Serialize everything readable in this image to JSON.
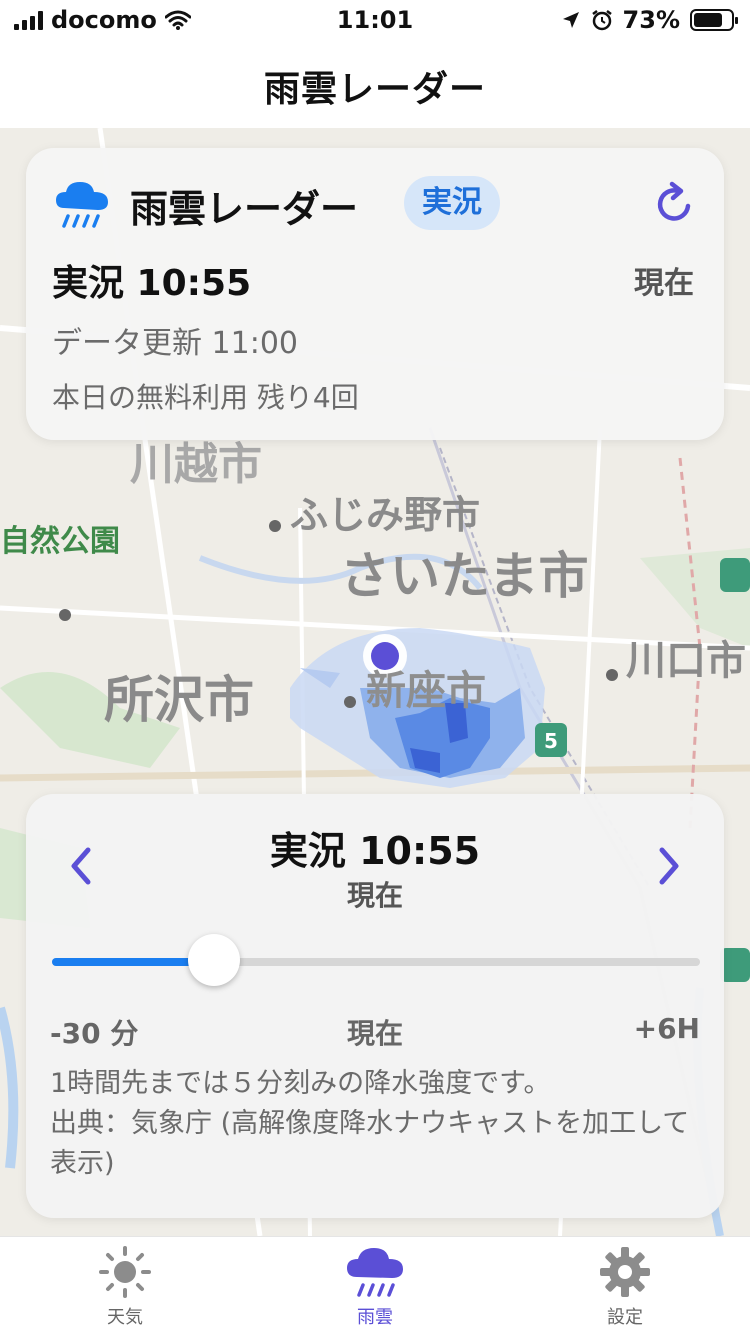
{
  "status_bar": {
    "carrier": "docomo",
    "time": "11:01",
    "battery": "73%"
  },
  "nav": {
    "title": "雨雲レーダー"
  },
  "map": {
    "labels": [
      "ふじみ野市",
      "さいたま市",
      "所沢市",
      "新座市",
      "川口市",
      "自然公園",
      "川越市"
    ]
  },
  "top_card": {
    "title": "雨雲レーダー",
    "badge": "実況",
    "time": "実況 10:55",
    "now": "現在",
    "updated": "データ更新 11:00",
    "free_usage": "本日の無料利用 残り4回"
  },
  "bottom_card": {
    "time": "実況 10:55",
    "now": "現在",
    "slider": {
      "value": 0.25
    },
    "ticks": {
      "left": "-30 分",
      "center": "現在",
      "right": "+6H"
    },
    "note": "1時間先までは５分刻みの降水強度です。\n出典：気象庁 (高解像度降水ナウキャストを加工して表示)"
  },
  "tabs": [
    {
      "label": "天気",
      "icon": "sun-icon"
    },
    {
      "label": "雨雲",
      "icon": "rain-cloud-icon"
    },
    {
      "label": "設定",
      "icon": "gear-icon"
    }
  ],
  "colors": {
    "accent": "#5b4fd6",
    "slider": "#1a7ef0",
    "badge_text": "#1e6fd9"
  }
}
